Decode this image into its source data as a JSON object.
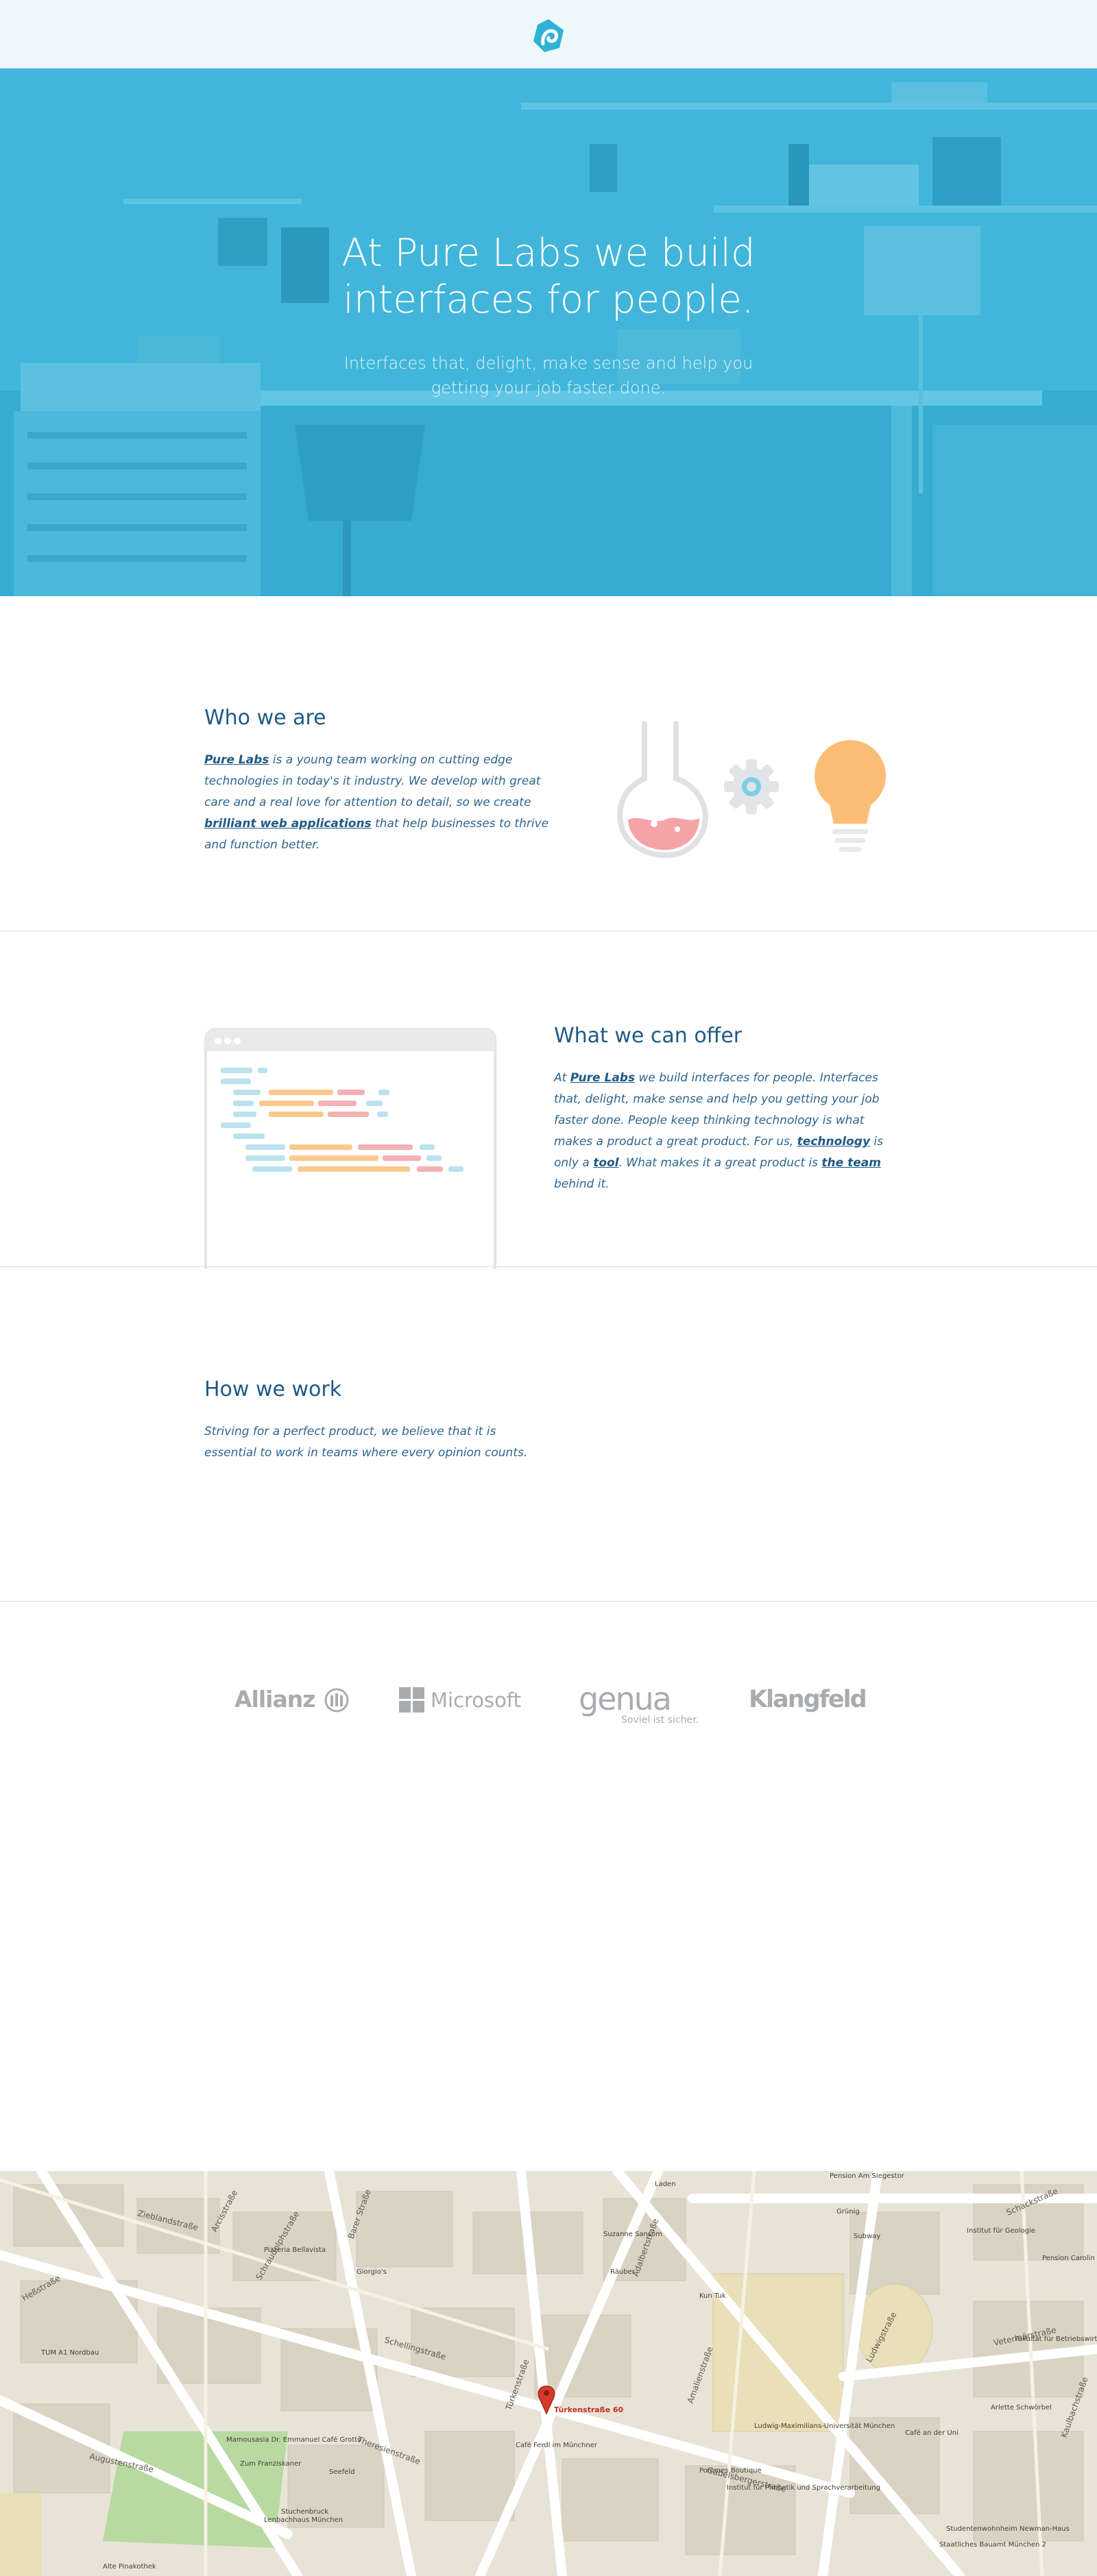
{
  "header": {
    "logo_icon": "pure-labs-logo-icon",
    "brand_color": "#2fb2d4"
  },
  "hero": {
    "title": "At Pure Labs we build interfaces for people.",
    "subtitle": "Interfaces that, delight, make sense and help you getting your job faster done.",
    "overlay_color": "#3bb2d6"
  },
  "who": {
    "title": "Who we are",
    "link_pure_labs": "Pure Labs",
    "text_1": " is a young team working on cutting edge technologies in today's it industry. We develop with great care and a real love for attention to detail, so we create ",
    "link_apps": "brilliant web applications",
    "text_2": " that help businesses to thrive and function better.",
    "icons": [
      "flask-icon",
      "gear-icon",
      "lightbulb-icon"
    ]
  },
  "offer": {
    "title": "What we can offer",
    "text_1": "At ",
    "link_pure_labs": "Pure Labs",
    "text_2": " we build interfaces for people. Interfaces that, delight, make sense and help you getting your job faster done. People keep thinking technology is what makes a product a great product. For us, ",
    "link_technology": "technology",
    "text_3": " is only a ",
    "link_tool": "tool",
    "text_4": ". What makes it a great product is ",
    "link_team": "the team",
    "text_5": " behind it."
  },
  "how": {
    "title": "How we work",
    "text": "Striving for a perfect product, we believe that it is essential to work in teams where every opinion counts."
  },
  "clients": {
    "allianz": "Allianz",
    "microsoft": "Microsoft",
    "genua": "genua",
    "genua_tagline": "Soviel ist sicher.",
    "klangfeld": "Klangfeld"
  },
  "map": {
    "marker_label": "Türkenstraße 60",
    "streets": [
      "Schellingstraße",
      "Theresienstraße",
      "Türkenstraße",
      "Amalienstraße",
      "Ludwigstraße",
      "Barer Straße",
      "Arcisstraße",
      "Gabelsbergerstraße",
      "Heßstraße",
      "Schraudolphstraße",
      "Zieblandstraße",
      "Adalbertstraße",
      "Veterinärstraße",
      "Schackstraße",
      "Kaulbachstraße",
      "Augustenstraße"
    ],
    "places": [
      "Pizzeria Bellavista",
      "Giorgio's",
      "Suzanne Sansom",
      "Räuber",
      "Kun Tuk",
      "Subway",
      "Institut für Geologie",
      "Pension Carolin",
      "Fakultät für Betriebswirtschaft",
      "Arlette Schwörbel",
      "Ludwig-Maximilians-Universität München",
      "Café an der Uni",
      "Café Ferdl im Münchner",
      "Pommes Boutique",
      "Mamousasia Dr. Emmanuel Café Grotto",
      "Seefeld",
      "Zum Franziskaner",
      "Stuchenbruck",
      "Studentenwohnheim Newman-Haus",
      "TUM A1 Nordbau",
      "Alte Pinakothek",
      "Pension Am Siegestor",
      "Laden",
      "Grünig",
      "Institut für Phonetik und Sprachverarbeitung",
      "Lenbachhaus München",
      "Staatliches Bauamt München 2"
    ]
  }
}
